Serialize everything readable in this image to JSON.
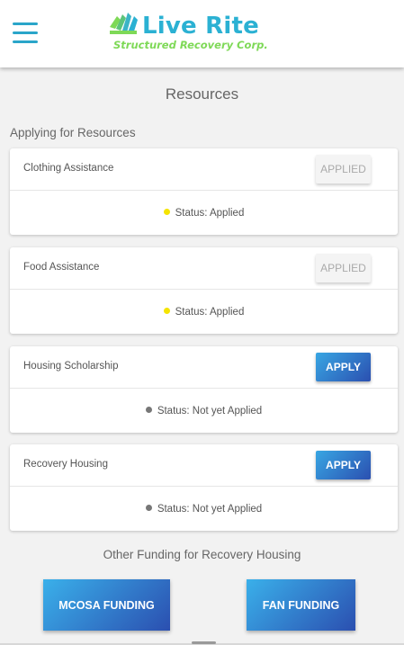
{
  "header": {
    "menu_icon": "hamburger-menu-icon",
    "logo": {
      "title": "Live Rite",
      "subtitle": "Structured Recovery Corp.",
      "colors": {
        "title": "#2bb1d3",
        "subtitle": "#7ed957"
      }
    }
  },
  "page": {
    "title": "Resources"
  },
  "applying": {
    "label": "Applying for Resources",
    "items": [
      {
        "name": "Clothing Assistance",
        "button": "APPLIED",
        "status": "Status: Applied",
        "status_color": "#f5e400",
        "applied": true
      },
      {
        "name": "Food Assistance",
        "button": "APPLIED",
        "status": "Status: Applied",
        "status_color": "#f5e400",
        "applied": true
      },
      {
        "name": "Housing Scholarship",
        "button": "APPLY",
        "status": "Status: Not yet Applied",
        "status_color": "#777777",
        "applied": false
      },
      {
        "name": "Recovery Housing",
        "button": "APPLY",
        "status": "Status: Not yet Applied",
        "status_color": "#777777",
        "applied": false
      }
    ]
  },
  "other_funding": {
    "label": "Other Funding for Recovery Housing",
    "buttons": [
      "MCOSA FUNDING",
      "FAN FUNDING"
    ]
  },
  "colors": {
    "accent": "#2aa5c9",
    "button_gradient_start": "#38a6e3",
    "button_gradient_end": "#2b4fb0"
  }
}
